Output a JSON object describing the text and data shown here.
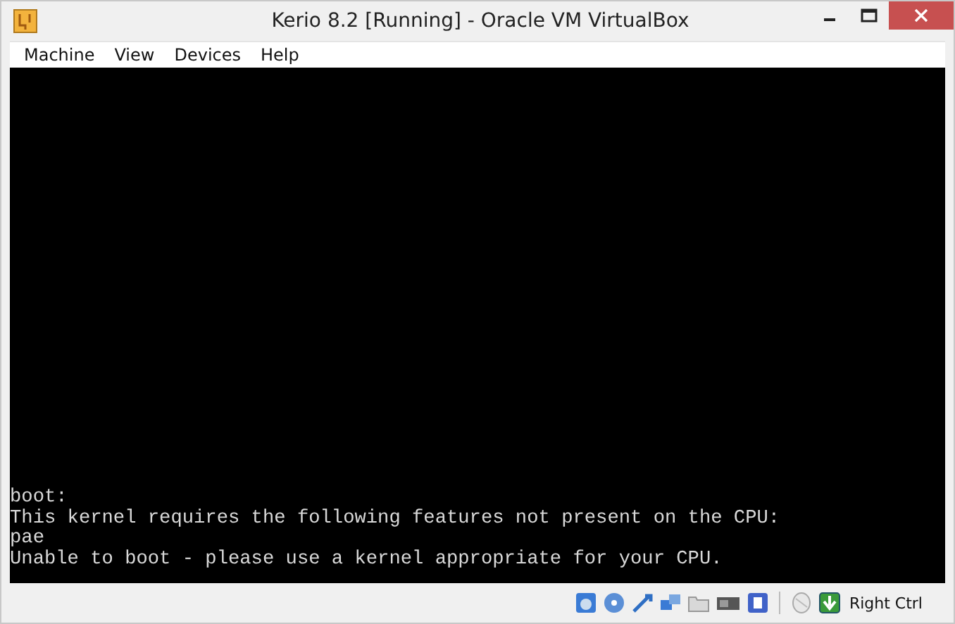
{
  "window": {
    "title": "Kerio 8.2 [Running] - Oracle VM VirtualBox"
  },
  "menu": [
    "Machine",
    "View",
    "Devices",
    "Help"
  ],
  "console": {
    "lines": [
      "boot:",
      "This kernel requires the following features not present on the CPU:",
      "pae",
      "Unable to boot - please use a kernel appropriate for your CPU."
    ]
  },
  "status_bar": {
    "host_key": "Right Ctrl"
  }
}
